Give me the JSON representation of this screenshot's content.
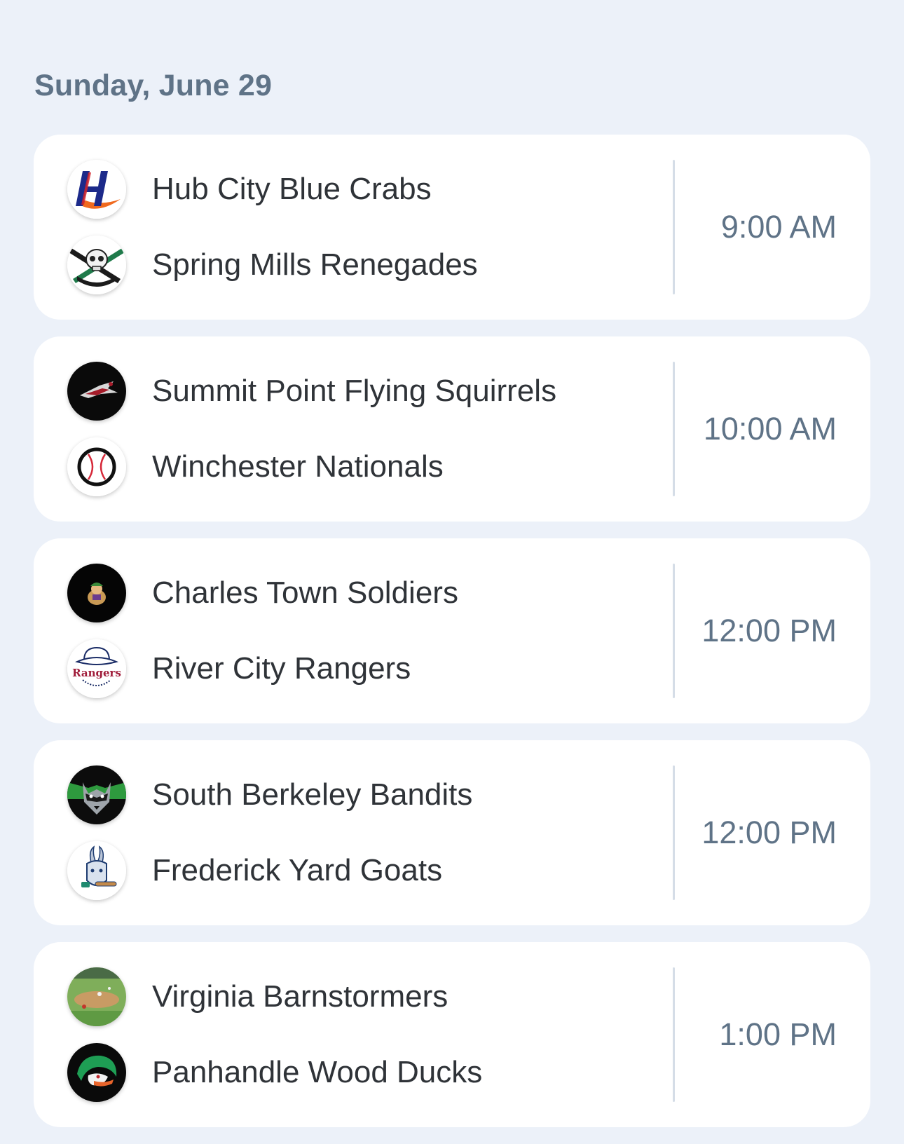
{
  "date_header": "Sunday, June 29",
  "games": [
    {
      "home": {
        "name": "Hub City Blue Crabs",
        "logo": "hub-city-blue-crabs-logo"
      },
      "away": {
        "name": "Spring Mills Renegades",
        "logo": "spring-mills-renegades-logo"
      },
      "time": "9:00 AM"
    },
    {
      "home": {
        "name": "Summit Point Flying Squirrels",
        "logo": "summit-point-flying-squirrels-logo"
      },
      "away": {
        "name": "Winchester Nationals",
        "logo": "winchester-nationals-logo"
      },
      "time": "10:00 AM"
    },
    {
      "home": {
        "name": "Charles Town Soldiers",
        "logo": "charles-town-soldiers-logo"
      },
      "away": {
        "name": "River City Rangers",
        "logo": "river-city-rangers-logo",
        "logo_text": "Rangers"
      },
      "time": "12:00 PM"
    },
    {
      "home": {
        "name": "South Berkeley Bandits",
        "logo": "south-berkeley-bandits-logo"
      },
      "away": {
        "name": "Frederick Yard Goats",
        "logo": "frederick-yard-goats-logo"
      },
      "time": "12:00 PM"
    },
    {
      "home": {
        "name": "Virginia Barnstormers",
        "logo": "virginia-barnstormers-logo"
      },
      "away": {
        "name": "Panhandle Wood Ducks",
        "logo": "panhandle-wood-ducks-logo"
      },
      "time": "1:00 PM"
    }
  ],
  "colors": {
    "background": "#ecf1f9",
    "card": "#ffffff",
    "date_text": "#5f7387",
    "team_text": "#2f3338",
    "time_text": "#5f7387",
    "divider": "#d5dde7"
  }
}
